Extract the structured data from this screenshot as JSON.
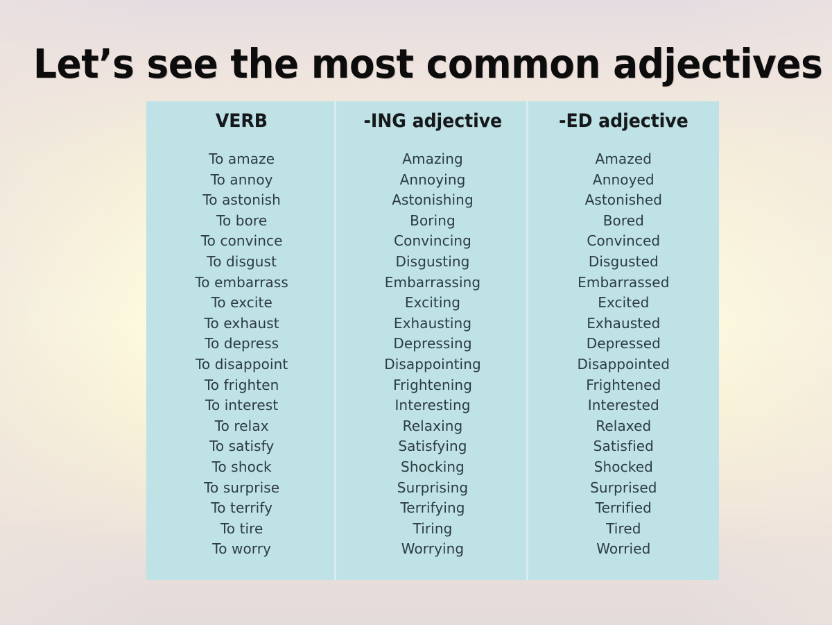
{
  "slide": {
    "title": "Let’s see the most common adjectives",
    "panel_color": "#bfe2e6",
    "title_color": "#0c0c0c",
    "text_color": "#2b3b40",
    "background_top_color": "#e4dce1",
    "background_mid_color": "#fdfade",
    "background_bottom_color": "#e4dcda"
  },
  "table": {
    "headers": [
      "VERB",
      "-ING adjective",
      "-ED adjective"
    ],
    "rows": [
      {
        "verb": "To amaze",
        "ing": "Amazing",
        "ed": "Amazed"
      },
      {
        "verb": "To annoy",
        "ing": "Annoying",
        "ed": "Annoyed"
      },
      {
        "verb": "To astonish",
        "ing": "Astonishing",
        "ed": "Astonished"
      },
      {
        "verb": "To bore",
        "ing": "Boring",
        "ed": "Bored"
      },
      {
        "verb": "To convince",
        "ing": "Convincing",
        "ed": "Convinced"
      },
      {
        "verb": "To disgust",
        "ing": "Disgusting",
        "ed": "Disgusted"
      },
      {
        "verb": "To embarrass",
        "ing": "Embarrassing",
        "ed": "Embarrassed"
      },
      {
        "verb": "To excite",
        "ing": "Exciting",
        "ed": "Excited"
      },
      {
        "verb": "To exhaust",
        "ing": "Exhausting",
        "ed": "Exhausted"
      },
      {
        "verb": "To depress",
        "ing": "Depressing",
        "ed": "Depressed"
      },
      {
        "verb": "To disappoint",
        "ing": "Disappointing",
        "ed": "Disappointed"
      },
      {
        "verb": "To frighten",
        "ing": "Frightening",
        "ed": "Frightened"
      },
      {
        "verb": "To interest",
        "ing": "Interesting",
        "ed": "Interested"
      },
      {
        "verb": "To relax",
        "ing": "Relaxing",
        "ed": "Relaxed"
      },
      {
        "verb": "To satisfy",
        "ing": "Satisfying",
        "ed": "Satisfied"
      },
      {
        "verb": "To shock",
        "ing": "Shocking",
        "ed": "Shocked"
      },
      {
        "verb": "To surprise",
        "ing": "Surprising",
        "ed": "Surprised"
      },
      {
        "verb": "To terrify",
        "ing": "Terrifying",
        "ed": "Terrified"
      },
      {
        "verb": "To tire",
        "ing": "Tiring",
        "ed": "Tired"
      },
      {
        "verb": "To worry",
        "ing": "Worrying",
        "ed": "Worried"
      }
    ]
  }
}
